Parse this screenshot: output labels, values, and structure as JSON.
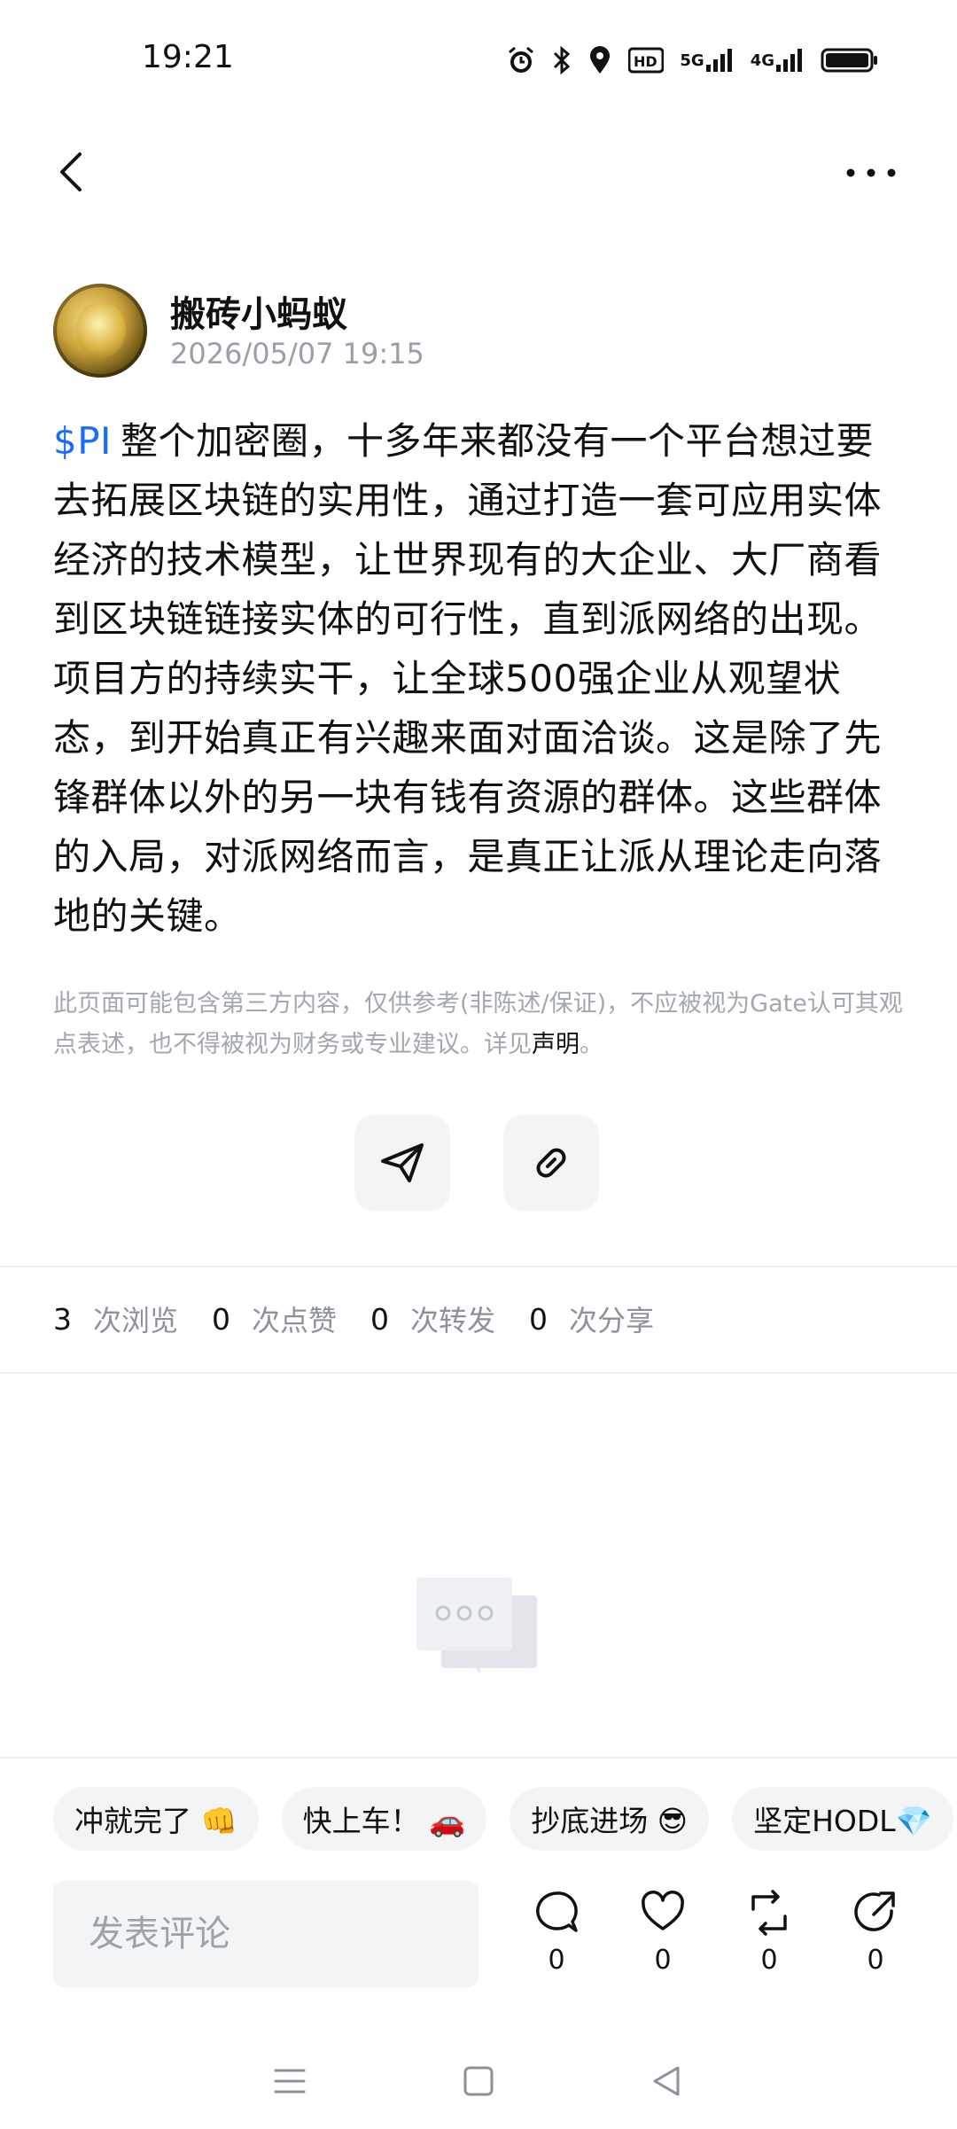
{
  "status_bar": {
    "time": "19:21",
    "hd_label": "HD",
    "net_5g": "5G",
    "net_4g": "4G",
    "icons": [
      "alarm-icon",
      "bluetooth-icon",
      "location-icon",
      "hd-icon",
      "signal-5g-icon",
      "signal-4g-icon",
      "battery-icon"
    ]
  },
  "nav": {
    "back_icon": "chevron-left-icon",
    "more_icon": "more-dots-icon"
  },
  "author": {
    "name": "搬砖小蚂蚁",
    "time": "2026/05/07 19:15"
  },
  "post": {
    "tag": "$PI",
    "body": "整个加密圈，十多年来都没有一个平台想过要去拓展区块链的实用性，通过打造一套可应用实体经济的技术模型，让世界现有的大企业、大厂商看到区块链链接实体的可行性，直到派网络的出现。项目方的持续实干，让全球500强企业从观望状态，到开始真正有兴趣来面对面洽谈。这是除了先锋群体以外的另一块有钱有资源的群体。这些群体的入局，对派网络而言，是真正让派从理论走向落地的关键。"
  },
  "disclaimer": {
    "text": "此页面可能包含第三方内容，仅供参考(非陈述/保证)，不应被视为Gate认可其观点表述，也不得被视为财务或专业建议。详见",
    "link": "声明",
    "end": "。"
  },
  "actions": {
    "send_icon": "send-icon",
    "link_icon": "link-icon"
  },
  "stats": {
    "views": "3",
    "views_label": "次浏览",
    "likes": "0",
    "likes_label": "次点赞",
    "reposts": "0",
    "reposts_label": "次转发",
    "shares": "0",
    "shares_label": "次分享"
  },
  "chips": [
    "冲就完了 👊",
    "快上车！ 🚗",
    "抄底进场 😎",
    "坚定HODL💎"
  ],
  "comment": {
    "placeholder": "发表评论"
  },
  "bottom_actions": {
    "comment_count": "0",
    "like_count": "0",
    "repost_count": "0",
    "share_count": "0"
  },
  "colors": {
    "accent": "#1a6bff",
    "muted": "#9a9ea6",
    "chip_bg": "#f3f4f6"
  }
}
